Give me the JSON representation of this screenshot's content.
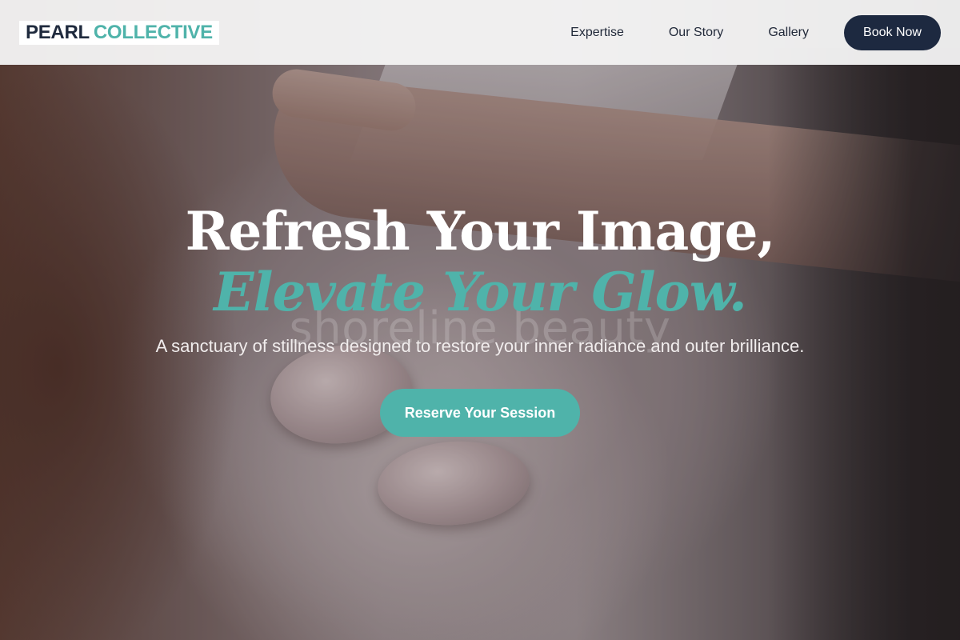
{
  "header": {
    "logo_word_1": "PEARL",
    "logo_word_2": "COLLECTIVE",
    "nav": [
      {
        "label": "Expertise"
      },
      {
        "label": "Our Story"
      },
      {
        "label": "Gallery"
      }
    ],
    "book_label": "Book Now"
  },
  "hero": {
    "headline_line_1": "Refresh Your Image,",
    "headline_line_2": "Elevate Your Glow.",
    "watermark": "shoreline beauty",
    "tagline": "A sanctuary of stillness designed to restore your inner radiance and outer brilliance.",
    "cta_label": "Reserve Your Session"
  },
  "colors": {
    "brand_navy": "#1d2940",
    "accent_teal": "#4fb3aa",
    "header_bg": "#f6f6f6"
  }
}
